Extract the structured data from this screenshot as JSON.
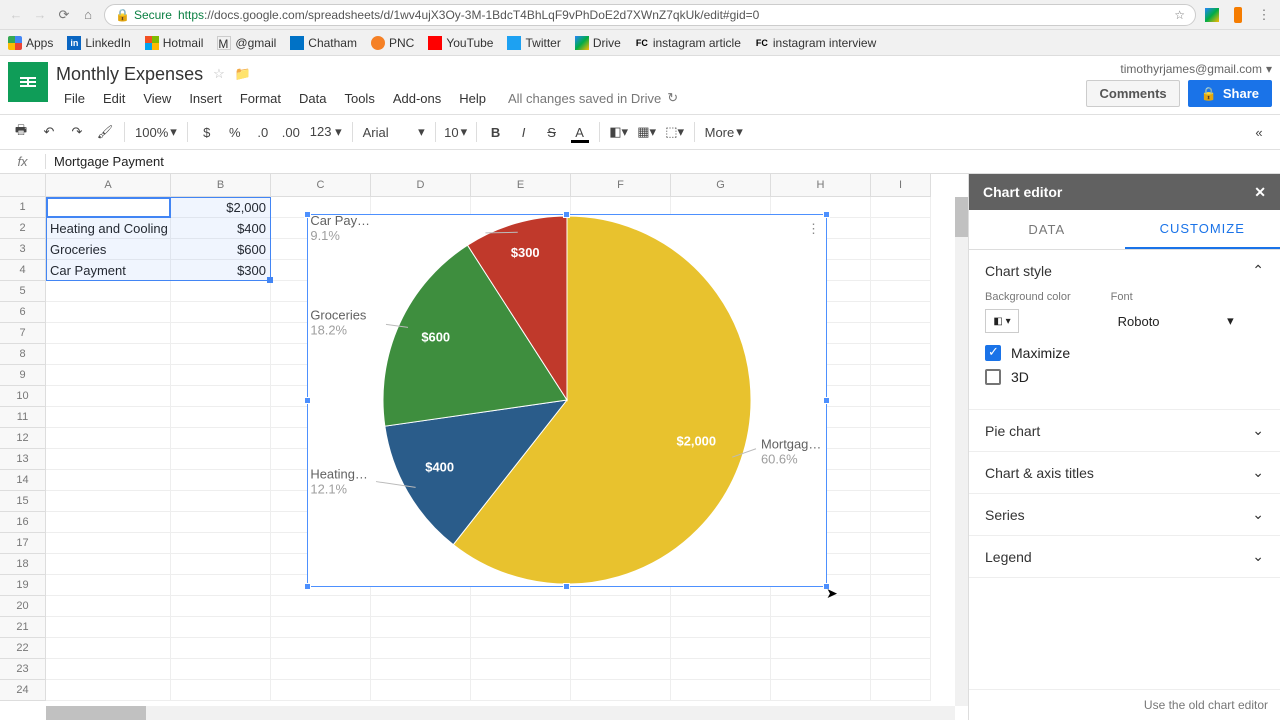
{
  "browser": {
    "secure_label": "Secure",
    "url_https": "https",
    "url_rest": "://docs.google.com/spreadsheets/d/1wv4ujX3Oy-3M-1BdcT4BhLqF9vPhDoE2d7XWnZ7qkUk/edit#gid=0"
  },
  "bookmarks": {
    "apps": "Apps",
    "linkedin": "LinkedIn",
    "hotmail": "Hotmail",
    "gmail": "@gmail",
    "chatham": "Chatham",
    "pnc": "PNC",
    "youtube": "YouTube",
    "twitter": "Twitter",
    "drive": "Drive",
    "fc1": "instagram article",
    "fc2": "instagram interview"
  },
  "doc": {
    "title": "Monthly Expenses"
  },
  "menu": {
    "file": "File",
    "edit": "Edit",
    "view": "View",
    "insert": "Insert",
    "format": "Format",
    "data": "Data",
    "tools": "Tools",
    "addons": "Add-ons",
    "help": "Help",
    "saved": "All changes saved in Drive"
  },
  "header": {
    "email": "timothyrjames@gmail.com",
    "comments": "Comments",
    "share": "Share"
  },
  "toolbar": {
    "zoom": "100%",
    "font": "Arial",
    "size": "10",
    "more": "More"
  },
  "fx": {
    "value": "Mortgage Payment"
  },
  "columns": [
    "A",
    "B",
    "C",
    "D",
    "E",
    "F",
    "G",
    "H",
    "I"
  ],
  "data_rows": [
    {
      "a": "Mortgage Payment",
      "b": "$2,000"
    },
    {
      "a": "Heating and Cooling",
      "b": "$400"
    },
    {
      "a": "Groceries",
      "b": "$600"
    },
    {
      "a": "Car Payment",
      "b": "$300"
    }
  ],
  "chart_data": {
    "type": "pie",
    "categories": [
      "Mortgage Payment",
      "Heating and Cooling",
      "Groceries",
      "Car Payment"
    ],
    "values": [
      2000,
      400,
      600,
      300
    ],
    "percents": [
      60.6,
      12.1,
      18.2,
      9.1
    ],
    "value_labels": [
      "$2,000",
      "$400",
      "$600",
      "$300"
    ],
    "colors": [
      "#E8C22E",
      "#2A5C8A",
      "#3E8E3E",
      "#C0392B"
    ],
    "leader_labels": [
      "Mortgag…",
      "Heating…",
      "Groceries",
      "Car Pay…"
    ],
    "leader_pcts": [
      "60.6%",
      "12.1%",
      "18.2%",
      "9.1%"
    ]
  },
  "sidebar": {
    "title": "Chart editor",
    "tabs": {
      "data": "DATA",
      "customize": "CUSTOMIZE"
    },
    "s_style": "Chart style",
    "bg_label": "Background color",
    "font_label": "Font",
    "font_value": "Roboto",
    "cb_max": "Maximize",
    "cb_3d": "3D",
    "s_pie": "Pie chart",
    "s_titles": "Chart & axis titles",
    "s_series": "Series",
    "s_legend": "Legend",
    "footer": "Use the old chart editor"
  }
}
